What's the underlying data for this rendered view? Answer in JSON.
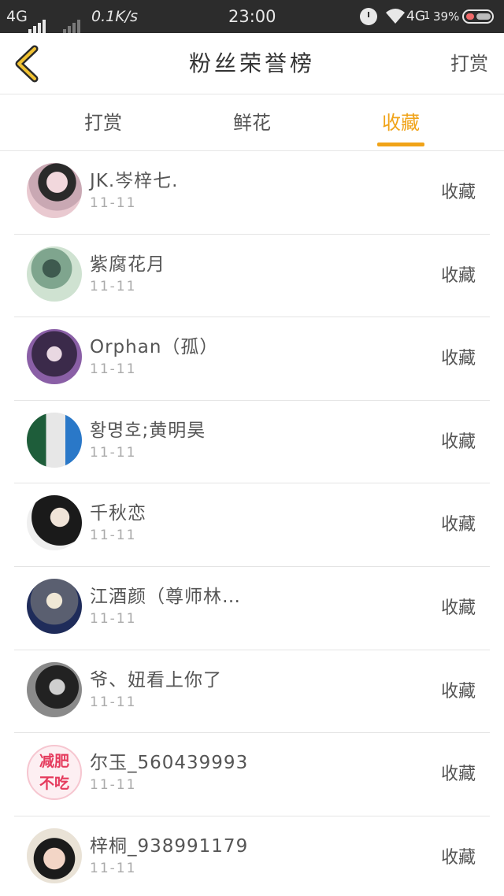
{
  "status_bar": {
    "network": "4G",
    "speed": "0.1K/s",
    "time": "23:00",
    "network2": "4G",
    "sim": "1",
    "battery": "39%"
  },
  "header": {
    "title": "粉丝荣誉榜",
    "right_action": "打赏"
  },
  "tabs": [
    {
      "label": "打赏",
      "active": false
    },
    {
      "label": "鲜花",
      "active": false
    },
    {
      "label": "收藏",
      "active": true
    }
  ],
  "accent_color": "#f0a318",
  "rows": [
    {
      "name": "JK.岑梓七.",
      "date": "11-11",
      "action": "收藏"
    },
    {
      "name": "紫腐花月",
      "date": "11-11",
      "action": "收藏"
    },
    {
      "name": "Orphan（孤）",
      "date": "11-11",
      "action": "收藏"
    },
    {
      "name": "황명호;黄明昊",
      "date": "11-11",
      "action": "收藏"
    },
    {
      "name": "千秋恋",
      "date": "11-11",
      "action": "收藏"
    },
    {
      "name": "江酒颜（尊师林…",
      "date": "11-11",
      "action": "收藏"
    },
    {
      "name": "爷、妞看上你了",
      "date": "11-11",
      "action": "收藏"
    },
    {
      "name": "尔玉_560439993",
      "date": "11-11",
      "action": "收藏"
    },
    {
      "name": "梓桐_938991179",
      "date": "11-11",
      "action": "收藏"
    }
  ],
  "avatar8_text": [
    "减肥",
    "不吃"
  ]
}
